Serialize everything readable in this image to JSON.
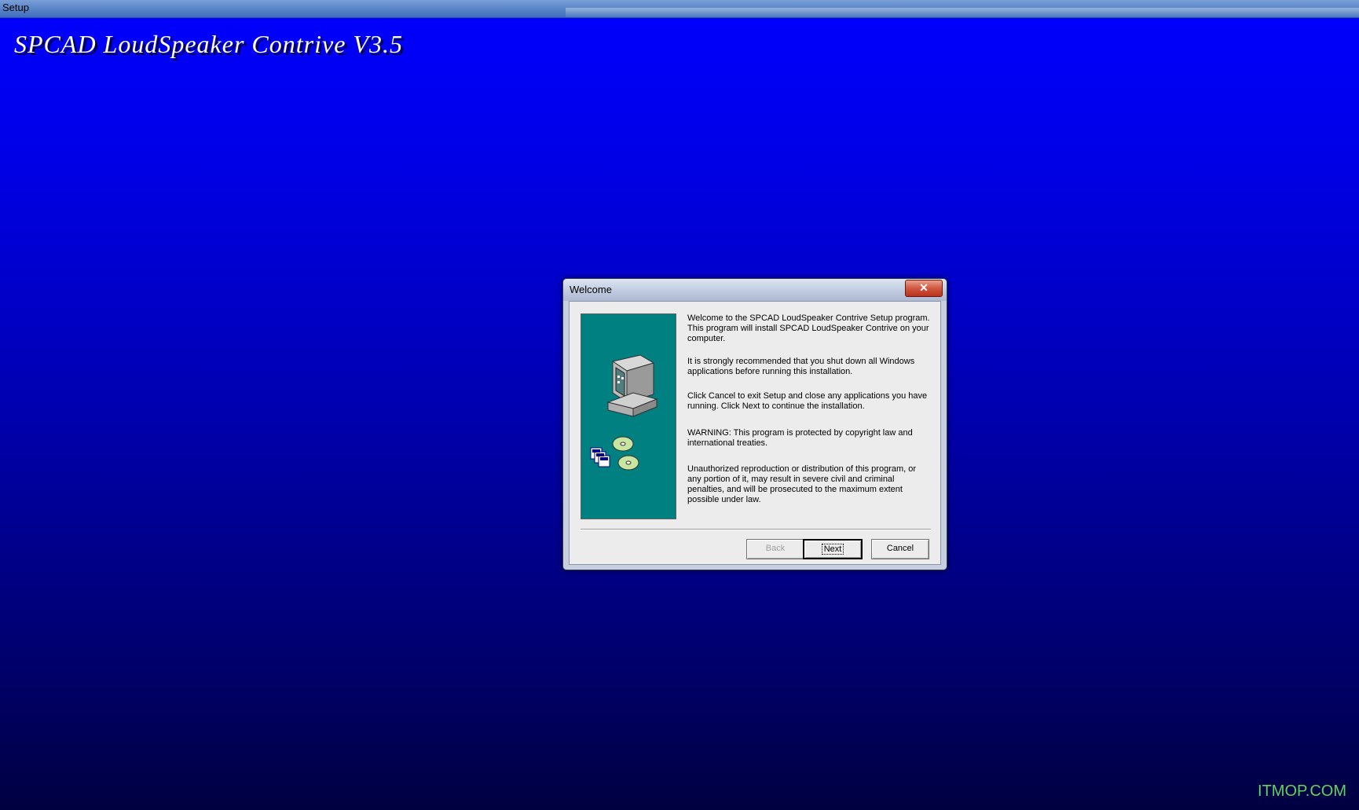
{
  "window": {
    "title": "Setup"
  },
  "app": {
    "title": "SPCAD LoudSpeaker Contrive V3.5"
  },
  "dialog": {
    "caption": "Welcome",
    "close_glyph": "✕",
    "paragraphs": [
      "Welcome to the SPCAD LoudSpeaker Contrive Setup program. This program will install SPCAD LoudSpeaker Contrive on your computer.",
      "It is strongly recommended that you shut down all Windows applications before running this installation.",
      "Click Cancel to exit Setup and close any applications you have running. Click Next to continue the installation.",
      "WARNING: This program is protected by copyright law and international treaties.",
      "Unauthorized reproduction or distribution of this program, or any portion of it, may result in severe civil and criminal penalties, and will be prosecuted to the maximum extent possible under law."
    ],
    "buttons": {
      "back": "Back",
      "next": "Next",
      "cancel": "Cancel"
    }
  },
  "watermark": "ITMOP.COM",
  "colors": {
    "background_top": "#0000ff",
    "background_bottom": "#000040",
    "side_panel": "#008080",
    "watermark": "#5fd35f"
  },
  "icons": [
    "computer-icon",
    "cd-disc-icon",
    "floppy-disks-icon",
    "close-icon"
  ]
}
